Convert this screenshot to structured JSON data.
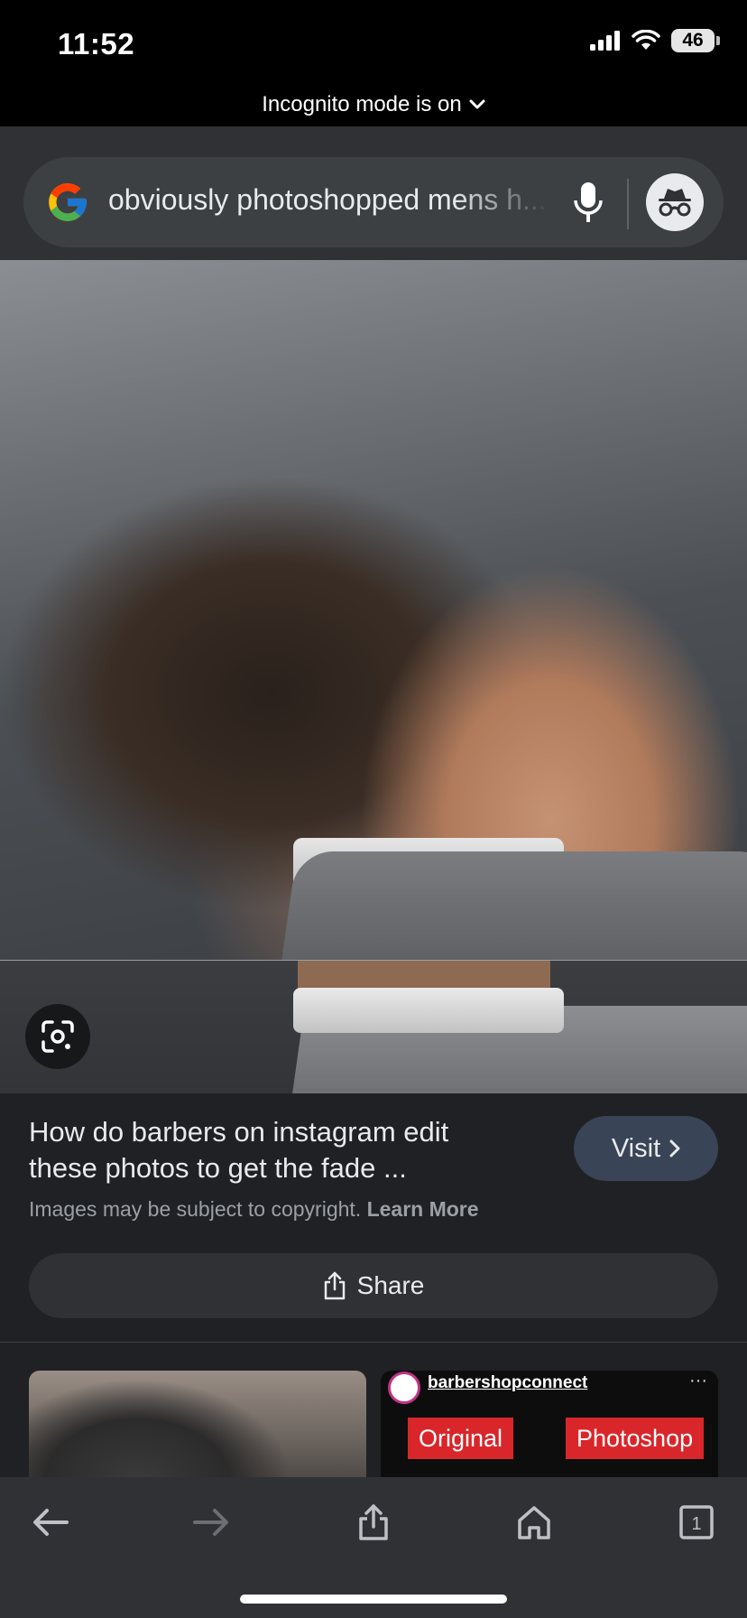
{
  "status_bar": {
    "time": "11:52",
    "battery": "46"
  },
  "incognito_banner": {
    "text": "Incognito mode is on"
  },
  "search": {
    "query": "obviously photoshopped mens h..."
  },
  "result": {
    "title": "How do barbers on instagram edit these photos to get the fade ...",
    "visit_label": "Visit",
    "copyright": "Images may be subject to copyright.",
    "learn_more": "Learn More",
    "share_label": "Share"
  },
  "related": [
    {
      "account": "barbershopconnect",
      "tag_left": "Original",
      "tag_right": "Photoshop"
    }
  ],
  "bottom_nav": {
    "tab_count": "1"
  },
  "colors": {
    "background": "#202124",
    "toolbar": "#303134",
    "visit_button": "#394457",
    "accent_red": "#d9262a"
  }
}
